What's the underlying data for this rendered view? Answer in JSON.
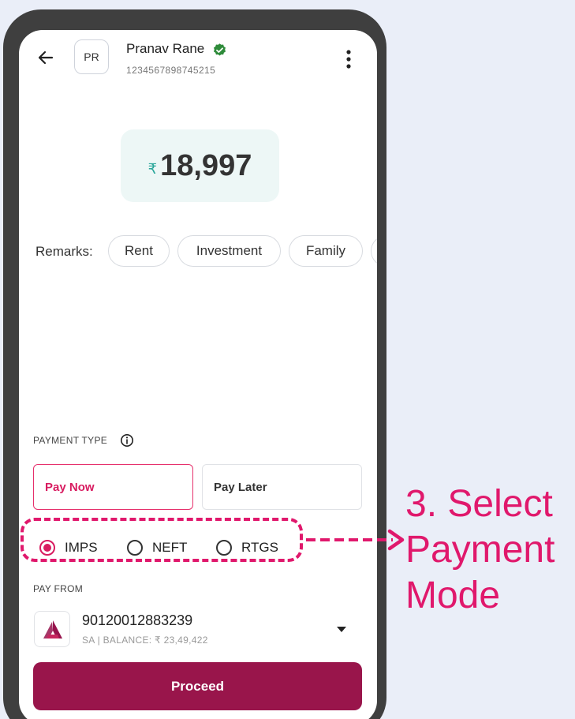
{
  "header": {
    "avatar_initials": "PR",
    "name": "Pranav Rane",
    "account_number": "1234567898745215"
  },
  "amount": {
    "currency_symbol": "₹",
    "value": "18,997"
  },
  "remarks": {
    "label": "Remarks:",
    "chips": [
      "Rent",
      "Investment",
      "Family"
    ]
  },
  "payment_type": {
    "label": "PAYMENT TYPE",
    "options": [
      "Pay Now",
      "Pay Later"
    ],
    "selected": "Pay Now"
  },
  "payment_modes": {
    "options": [
      "IMPS",
      "NEFT",
      "RTGS"
    ],
    "selected": "IMPS"
  },
  "pay_from": {
    "label": "PAY FROM",
    "account_number": "90120012883239",
    "meta": "SA | BALANCE: ₹ 23,49,422"
  },
  "proceed_label": "Proceed",
  "annotation": {
    "lines": [
      "3. Select",
      "Payment",
      "Mode"
    ]
  },
  "colors": {
    "accent": "#d81b60",
    "primary_button": "#99154b",
    "annotation": "#e0186c",
    "verified": "#2e8b3a",
    "amount_bg": "#edf7f6",
    "frame": "#3f3f3f",
    "background": "#eaeef8"
  },
  "icons": {
    "back": "back-arrow-icon",
    "verified": "verified-badge-icon",
    "menu": "kebab-menu-icon",
    "info": "info-icon",
    "bank": "axis-bank-logo",
    "dropdown": "caret-down-icon"
  }
}
